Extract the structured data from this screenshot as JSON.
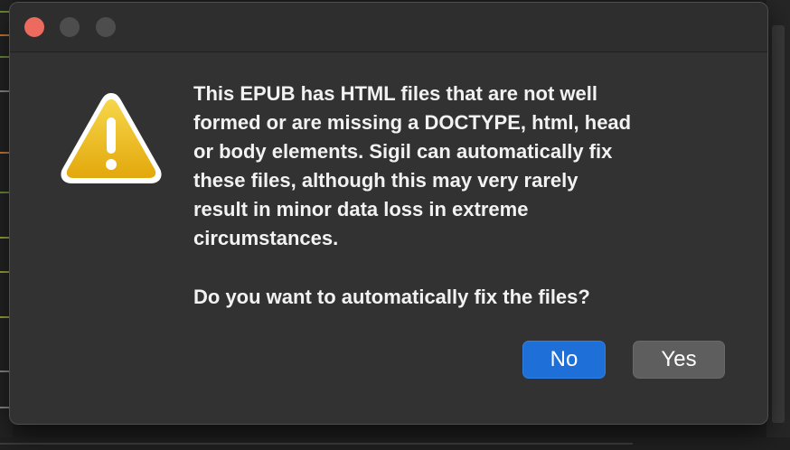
{
  "window": {
    "controls": [
      "close",
      "minimize",
      "zoom"
    ]
  },
  "icon": "warning-triangle-icon",
  "message": "This EPUB has HTML files that are not well\nformed or are missing a DOCTYPE, html, head\nor body elements. Sigil can automatically fix\nthese files, although this may very rarely\nresult in minor data loss in extreme\ncircumstances.",
  "question": "Do you want to automatically fix the files?",
  "buttons": {
    "no": "No",
    "yes": "Yes"
  },
  "colors": {
    "primary_button": "#1f6fd8",
    "close_light": "#ec6a5e",
    "warning_yellow": "#f2c418"
  }
}
